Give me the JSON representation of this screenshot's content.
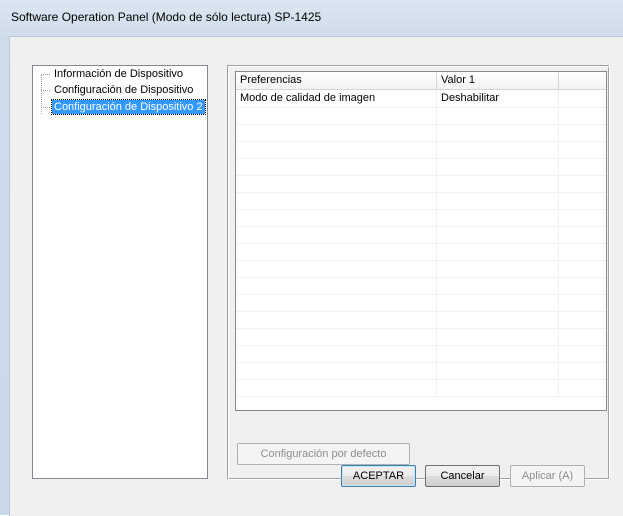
{
  "window": {
    "title": "Software Operation Panel (Modo de sólo lectura) SP-1425"
  },
  "tree": {
    "items": [
      {
        "label": "Información de Dispositivo",
        "selected": false
      },
      {
        "label": "Configuración de Dispositivo",
        "selected": false
      },
      {
        "label": "Configuración de Dispositivo 2",
        "selected": true
      }
    ]
  },
  "table": {
    "columns": [
      "Preferencias",
      "Valor 1",
      ""
    ],
    "rows": [
      [
        "Modo de calidad de imagen",
        "Deshabilitar",
        ""
      ]
    ]
  },
  "buttons": {
    "default_config": "Configuración por defecto",
    "ok": "ACEPTAR",
    "cancel": "Cancelar",
    "apply": "Aplicar (A)"
  },
  "colors": {
    "selection": "#3399ff",
    "client_bg": "#f0f0f0"
  }
}
